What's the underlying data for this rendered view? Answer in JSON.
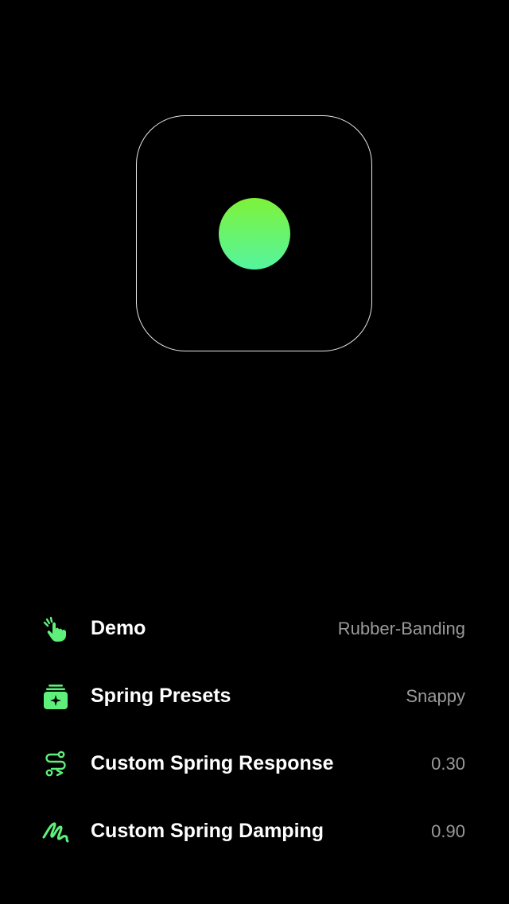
{
  "theme": {
    "background": "#000000",
    "accent": "#5ef07a",
    "accent_gradient": [
      "#7ef23a",
      "#55f59f"
    ],
    "label_color": "#ffffff",
    "value_color": "#9a9a9a"
  },
  "demo_area": {
    "icon": "spring-ball"
  },
  "settings": [
    {
      "icon": "hand-tap-icon",
      "label": "Demo",
      "value": "Rubber-Banding"
    },
    {
      "icon": "presets-stack-icon",
      "label": "Spring Presets",
      "value": "Snappy"
    },
    {
      "icon": "path-route-icon",
      "label": "Custom Spring Response",
      "value": "0.30"
    },
    {
      "icon": "scribble-icon",
      "label": "Custom Spring Damping",
      "value": "0.90"
    }
  ]
}
